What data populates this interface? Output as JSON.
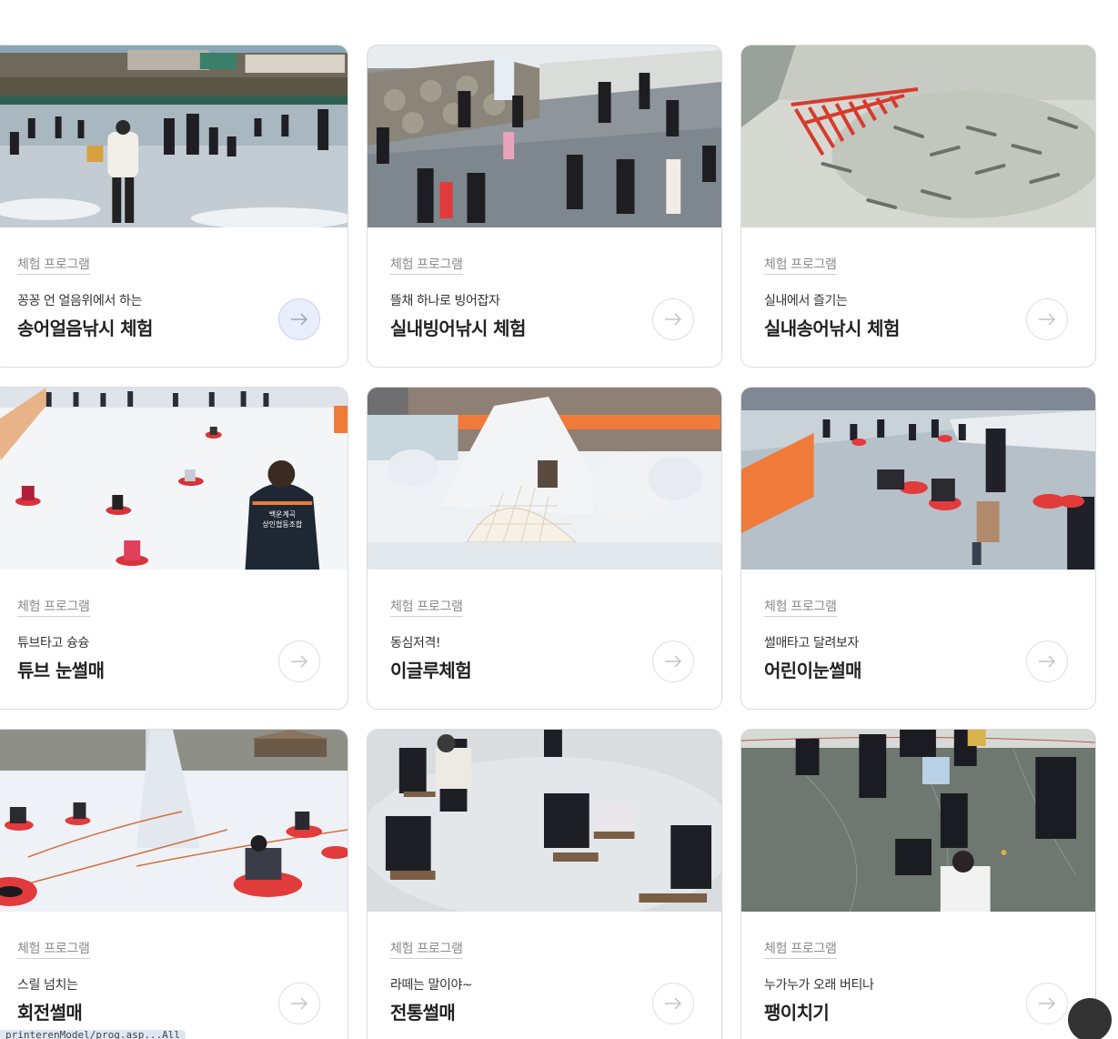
{
  "cards": [
    {
      "tag": "체험 프로그램",
      "subtitle": "꽁꽁 언 얼음위에서 하는",
      "title": "송어얼음낚시 체험",
      "image": "ice-fishing-photo"
    },
    {
      "tag": "체험 프로그램",
      "subtitle": "뜰채 하나로 빙어잡자",
      "title": "실내빙어낚시 체험",
      "image": "smelt-catching-photo"
    },
    {
      "tag": "체험 프로그램",
      "subtitle": "실내에서 즐기는",
      "title": "실내송어낚시 체험",
      "image": "trout-net-photo"
    },
    {
      "tag": "체험 프로그램",
      "subtitle": "튜브타고 슝슝",
      "title": "튜브 눈썰매",
      "image": "tube-sled-photo",
      "badge_line1": "백운계곡",
      "badge_line2": "상인협동조합"
    },
    {
      "tag": "체험 프로그램",
      "subtitle": "동심저격!",
      "title": "이글루체험",
      "image": "igloo-photo"
    },
    {
      "tag": "체험 프로그램",
      "subtitle": "썰매타고 달려보자",
      "title": "어린이눈썰매",
      "image": "kids-sled-photo"
    },
    {
      "tag": "체험 프로그램",
      "subtitle": "스릴 넘치는",
      "title": "회전썰매",
      "image": "rotating-sled-photo"
    },
    {
      "tag": "체험 프로그램",
      "subtitle": "라떼는 말이야~",
      "title": "전통썰매",
      "image": "traditional-sled-photo"
    },
    {
      "tag": "체험 프로그램",
      "subtitle": "누가누가 오래 버티나",
      "title": "팽이치기",
      "image": "top-spinning-photo"
    }
  ],
  "status_tip": "printerenModel/prog.asp...All",
  "colors": {
    "accent_active": "#e8eefb",
    "fab": "#333333",
    "tube_red": "#e23b3b",
    "fence_orange": "#f07a3a"
  }
}
